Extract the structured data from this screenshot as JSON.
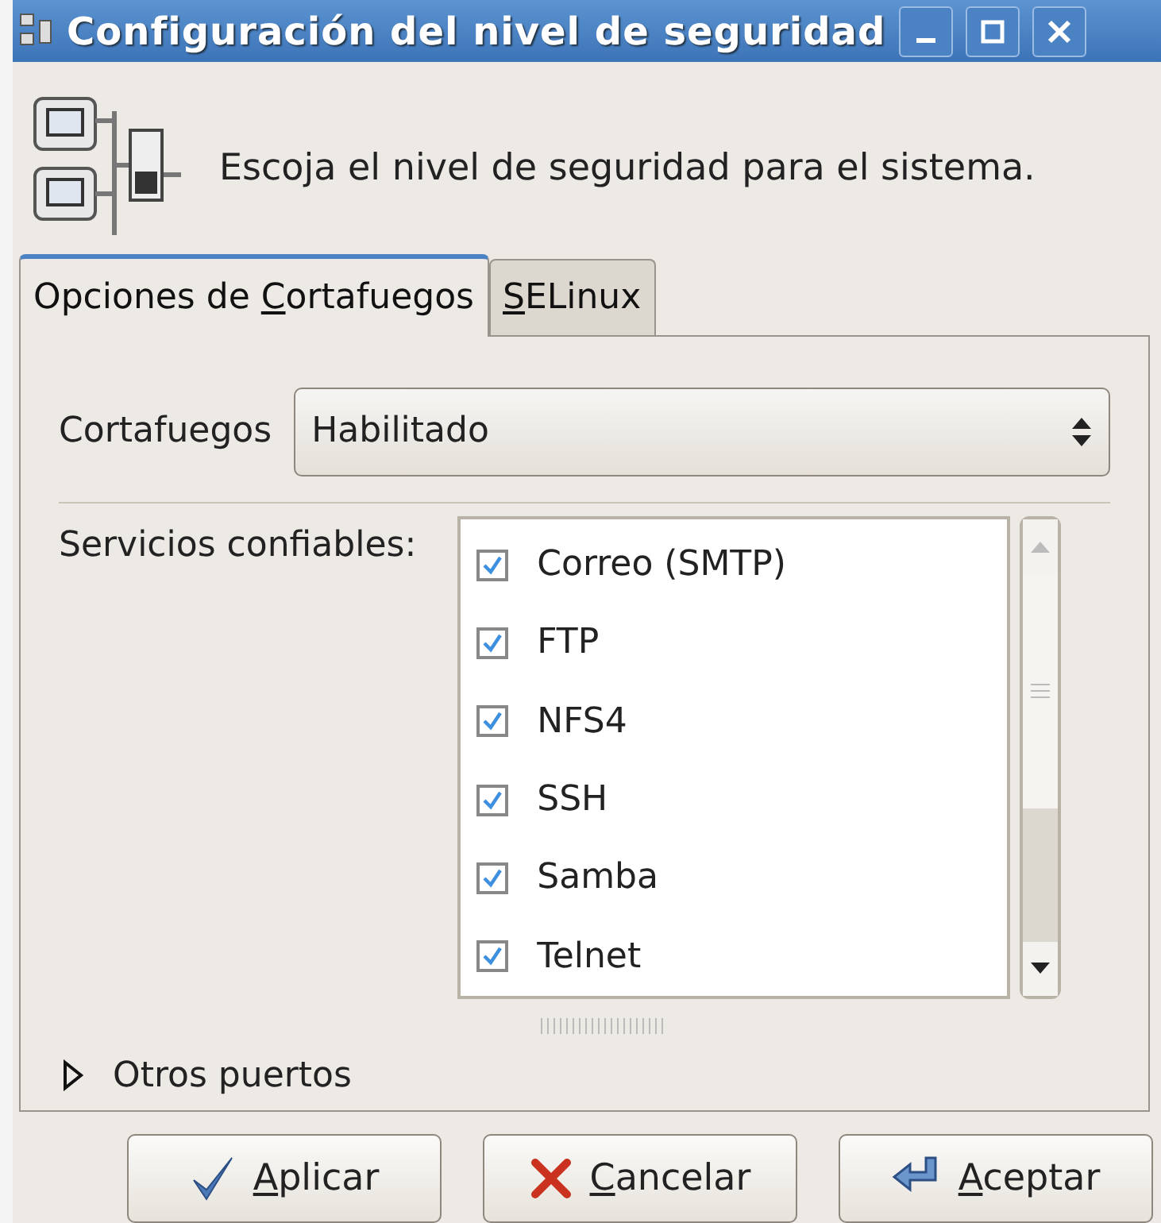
{
  "window": {
    "title": "Configuración del nivel de seguridad"
  },
  "header": {
    "text": "Escoja el nivel de seguridad para el sistema."
  },
  "tabs": [
    {
      "label": {
        "before": "Opciones de ",
        "key": "C",
        "after": "ortafuegos"
      },
      "selected": true
    },
    {
      "label": {
        "key": "S",
        "after": "ELinux"
      },
      "selected": false
    }
  ],
  "firewall": {
    "label": "Cortafuegos",
    "value": "Habilitado"
  },
  "trusted_services": {
    "label": "Servicios confiables:",
    "items": [
      {
        "name": "Correo (SMTP)",
        "checked": true
      },
      {
        "name": "FTP",
        "checked": true
      },
      {
        "name": "NFS4",
        "checked": true
      },
      {
        "name": "SSH",
        "checked": true
      },
      {
        "name": "Samba",
        "checked": true
      },
      {
        "name": "Telnet",
        "checked": true
      }
    ]
  },
  "other_ports": {
    "label": "Otros puertos",
    "expanded": false
  },
  "buttons": [
    {
      "kind": "apply",
      "label": {
        "key": "A",
        "after": "plicar"
      }
    },
    {
      "kind": "cancel",
      "label": {
        "key": "C",
        "after": "ancelar"
      }
    },
    {
      "kind": "ok",
      "label": {
        "key": "A",
        "after": "ceptar"
      }
    }
  ]
}
